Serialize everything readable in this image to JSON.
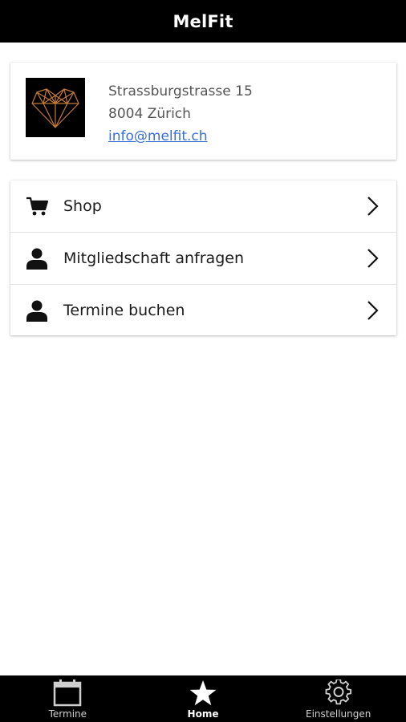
{
  "app": {
    "title": "MelFit"
  },
  "info": {
    "street": "Strassburgstrasse 15",
    "city": "8004 Zürich",
    "email": "info@melfit.ch",
    "logo_icon": "heart-diamond-logo",
    "logo_color": "#c47a3a"
  },
  "menu": {
    "items": [
      {
        "label": "Shop",
        "icon": "cart-icon"
      },
      {
        "label": "Mitgliedschaft anfragen",
        "icon": "person-icon"
      },
      {
        "label": "Termine buchen",
        "icon": "person-icon"
      }
    ]
  },
  "tabs": [
    {
      "label": "Termine",
      "icon": "calendar-icon",
      "active": false
    },
    {
      "label": "Home",
      "icon": "star-icon",
      "active": true
    },
    {
      "label": "Einstellungen",
      "icon": "gear-icon",
      "active": false
    }
  ],
  "colors": {
    "bar": "#000000",
    "link": "#3a6fd8",
    "text": "#1a1a1a"
  }
}
